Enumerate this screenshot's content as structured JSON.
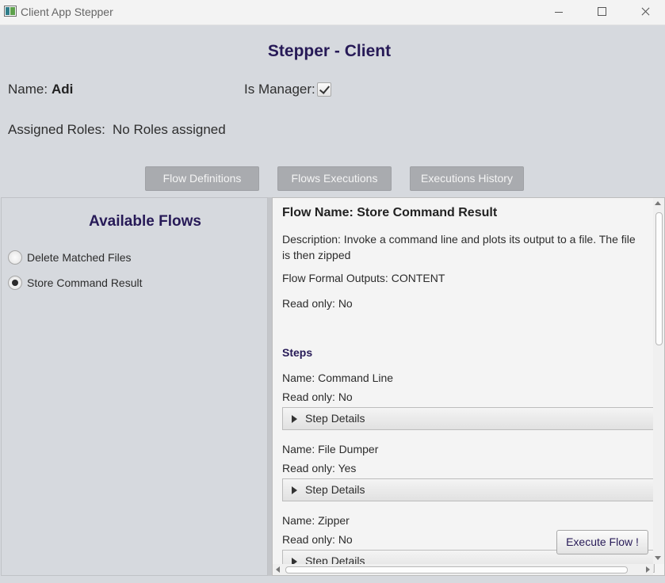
{
  "window": {
    "title": "Client App Stepper"
  },
  "header": {
    "title": "Stepper - Client",
    "name_label": "Name:",
    "name_value": "Adi",
    "manager_label": "Is Manager:",
    "is_manager": true,
    "roles_label": "Assigned Roles:",
    "roles_value": "No Roles assigned"
  },
  "tabs": [
    "Flow Definitions",
    "Flows Executions",
    "Executions History"
  ],
  "sidebar": {
    "title": "Available Flows",
    "flows": [
      {
        "label": "Delete Matched Files",
        "selected": false
      },
      {
        "label": "Store Command Result",
        "selected": true
      }
    ]
  },
  "details": {
    "flow_name": "Flow Name: Store Command Result",
    "description": "Description: Invoke a command line and plots its output to a file. The file is then zipped",
    "formal_outputs": "Flow Formal Outputs: CONTENT",
    "read_only": "Read only: No",
    "steps_heading": "Steps",
    "step_details_label": "Step Details",
    "steps": [
      {
        "name": "Name: Command Line",
        "read_only": "Read only: No"
      },
      {
        "name": "Name: File Dumper",
        "read_only": "Read only: Yes"
      },
      {
        "name": "Name: Zipper",
        "read_only": "Read only: No"
      }
    ],
    "execute_label": "Execute Flow !"
  }
}
